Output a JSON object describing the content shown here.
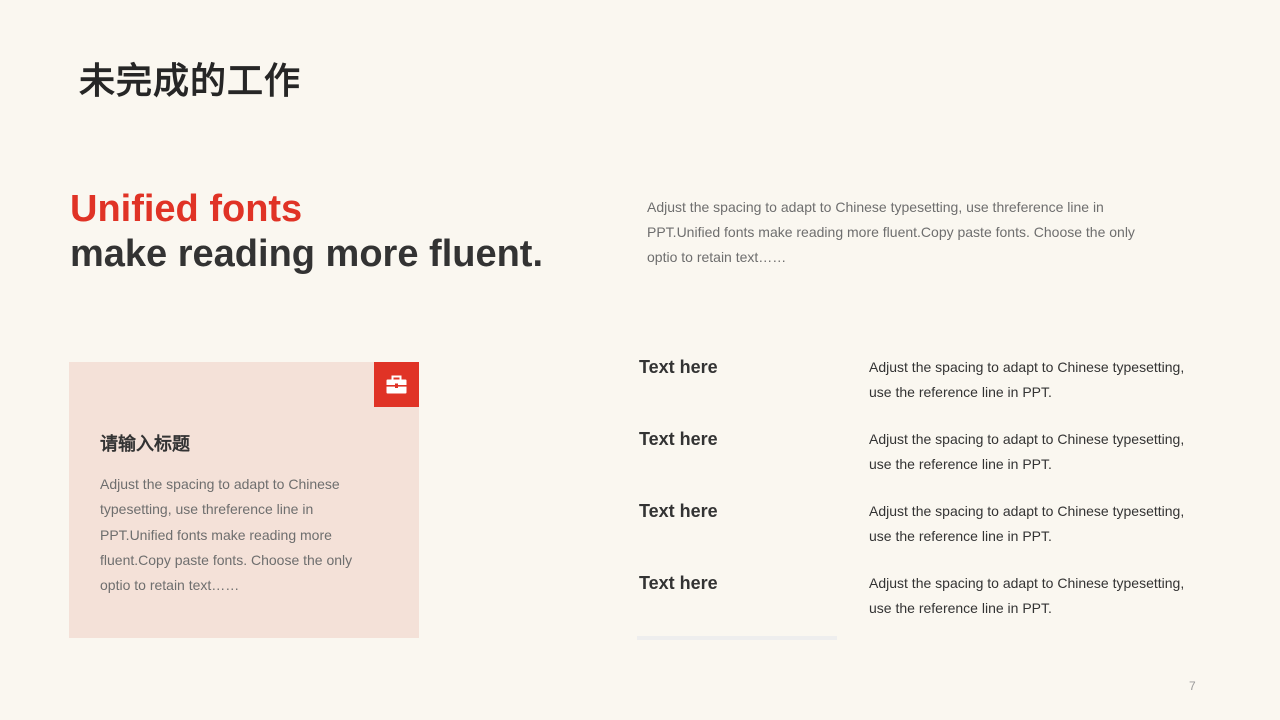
{
  "slide": {
    "title": "未完成的工作",
    "page_number": "7"
  },
  "headline": {
    "accent": "Unified fonts",
    "main": "make reading more fluent."
  },
  "intro": {
    "text": "Adjust the spacing to adapt to Chinese typesetting, use threference line in PPT.Unified fonts make reading more fluent.Copy paste fonts. Choose the only optio to retain text……"
  },
  "card": {
    "icon": "toolbox-icon",
    "title": "请输入标题",
    "body": "Adjust the spacing to adapt to Chinese typesetting, use threference line in PPT.Unified fonts make reading more fluent.Copy paste fonts. Choose the only optio to retain text……"
  },
  "list": {
    "items": [
      {
        "title": "Text here",
        "desc": "Adjust the spacing to adapt to Chinese typesetting, use the reference line in PPT."
      },
      {
        "title": "Text here",
        "desc": "Adjust the spacing to adapt to Chinese typesetting, use the reference line in PPT."
      },
      {
        "title": "Text here",
        "desc": "Adjust the spacing to adapt to Chinese typesetting, use the reference line in PPT."
      },
      {
        "title": "Text here",
        "desc": "Adjust the spacing to adapt to Chinese typesetting, use the reference line in PPT."
      }
    ]
  },
  "colors": {
    "background": "#faf7f0",
    "accent": "#e03326",
    "card_fill": "#f4e1d8",
    "text_dark": "#333333",
    "text_muted": "#6e6e6e"
  }
}
